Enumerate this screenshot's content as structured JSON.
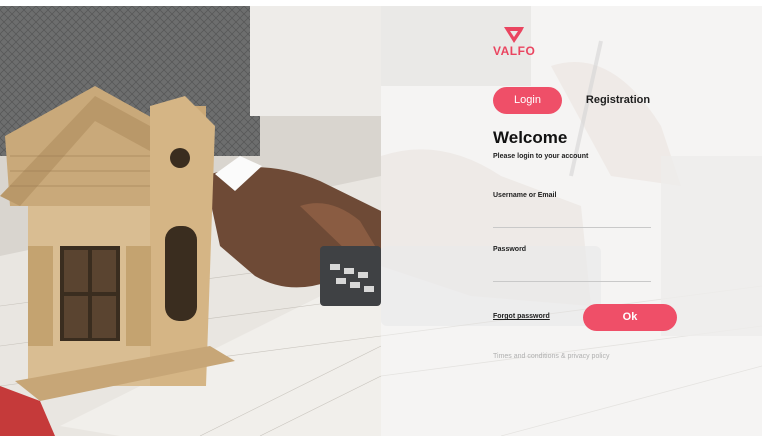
{
  "brand": {
    "name": "VALFO",
    "accent": "#ef4f68"
  },
  "tabs": {
    "login_label": "Login",
    "registration_label": "Registration"
  },
  "header": {
    "title": "Welcome",
    "subtitle": "Please login to your account"
  },
  "form": {
    "username_label": "Username or Email",
    "username_value": "",
    "password_label": "Password",
    "password_value": "",
    "forgot_label": "Forgot password",
    "submit_label": "Ok"
  },
  "footer": {
    "terms_label": "Times and conditions & privacy policy"
  }
}
